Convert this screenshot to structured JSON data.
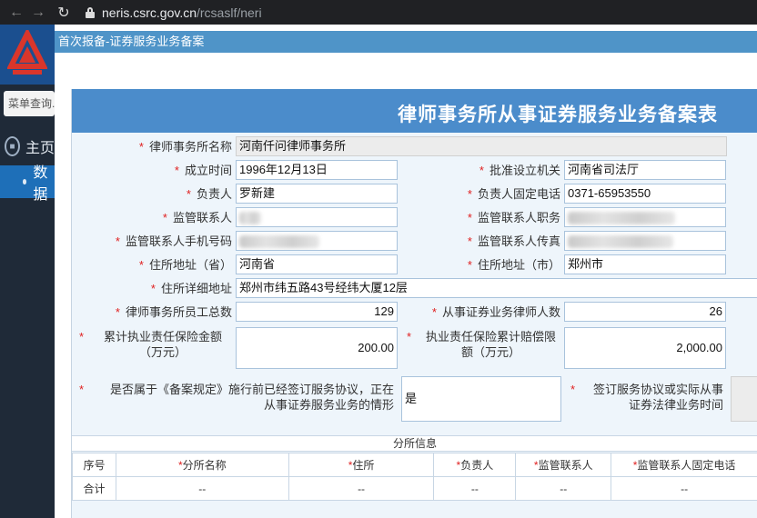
{
  "browser": {
    "url_host": "neris.csrc.gov.cn",
    "url_path": "/rcsaslf/neri"
  },
  "background_app": {
    "search_placeholder": "菜单查询...",
    "main_menu_label": "主页",
    "sub_menu_label": "数据"
  },
  "modal": {
    "title": "首次报备-证券服务业务备案"
  },
  "form": {
    "title": "律师事务所从事证券服务业务备案表",
    "firm_name": {
      "label": "律师事务所名称",
      "value": "河南仟问律师事务所"
    },
    "established": {
      "label": "成立时间",
      "value": "1996年12月13日"
    },
    "approval_org": {
      "label": "批准设立机关",
      "value": "河南省司法厅"
    },
    "principal": {
      "label": "负责人",
      "value": "罗新建"
    },
    "principal_phone": {
      "label": "负责人固定电话",
      "value": "0371-65953550"
    },
    "supervisor": {
      "label": "监管联系人",
      "value": ""
    },
    "supervisor_title": {
      "label": "监管联系人职务",
      "value": ""
    },
    "supervisor_mobile": {
      "label": "监管联系人手机号码",
      "value": ""
    },
    "supervisor_fax": {
      "label": "监管联系人传真",
      "value": ""
    },
    "addr_province": {
      "label": "住所地址（省）",
      "value": "河南省"
    },
    "addr_city": {
      "label": "住所地址（市）",
      "value": "郑州市"
    },
    "addr_detail": {
      "label": "住所详细地址",
      "value": "郑州市纬五路43号经纬大厦12层"
    },
    "staff_total": {
      "label": "律师事务所员工总数",
      "value": "129"
    },
    "securities_lawyers": {
      "label": "从事证券业务律师人数",
      "value": "26"
    },
    "insurance_amount": {
      "label": "累计执业责任保险金额（万元）",
      "value": "200.00"
    },
    "insurance_limit": {
      "label": "执业责任保险累计赔偿限额（万元）",
      "value": "2,000.00"
    },
    "pre_agreement": {
      "label": "是否属于《备案规定》施行前已经签订服务协议，正在从事证券服务业务的情形",
      "value": "是"
    },
    "agreement_time": {
      "label": "签订服务协议或实际从事证券法律业务时间",
      "value": ""
    }
  },
  "branch": {
    "section_title": "分所信息",
    "headers": [
      "序号",
      "分所名称",
      "住所",
      "负责人",
      "监管联系人",
      "监管联系人固定电话"
    ],
    "required": [
      false,
      true,
      true,
      true,
      true,
      true
    ],
    "total_row": [
      "合计",
      "--",
      "--",
      "--",
      "--",
      "--"
    ]
  },
  "colors": {
    "browser_bar": "#202124",
    "modal_title_bg": "#4f94c8",
    "form_header_bg": "#4b8ccb",
    "form_bg": "#eef5fb",
    "required_mark": "#e02020"
  }
}
